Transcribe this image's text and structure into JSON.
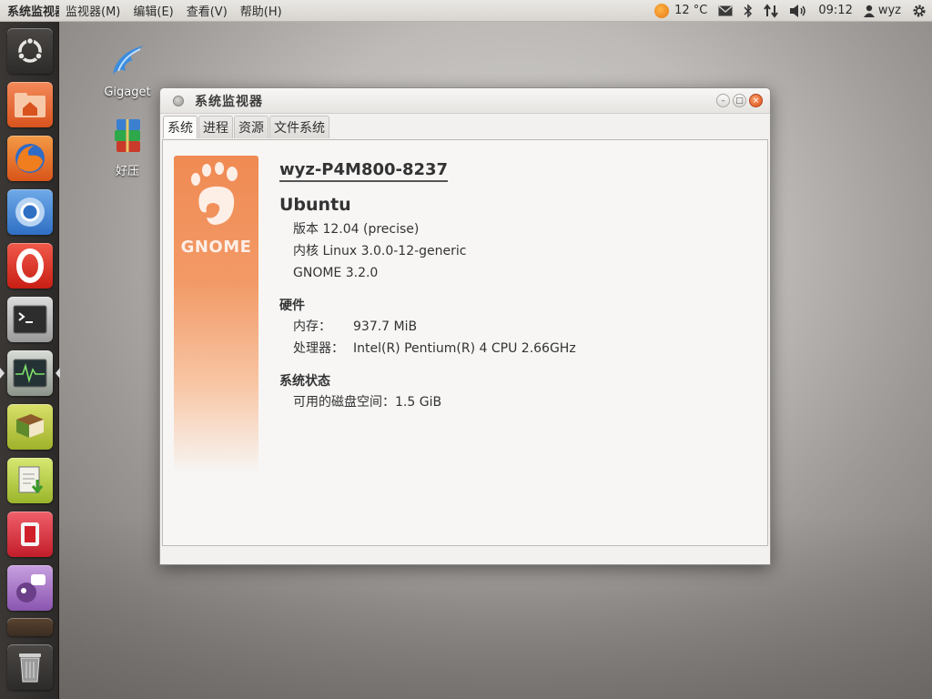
{
  "top_panel": {
    "app_title": "系统监视器",
    "menus": [
      "监视器(M)",
      "编辑(E)",
      "查看(V)",
      "帮助(H)"
    ],
    "temperature": "12 °C",
    "time": "09:12",
    "user": "wyz"
  },
  "launcher": {
    "items": [
      "dash-home",
      "home-folder",
      "firefox",
      "chromium",
      "opera",
      "terminal",
      "system-monitor",
      "dictionary",
      "software-updater",
      "startup-disk",
      "pidgin",
      "trash"
    ]
  },
  "desktop": {
    "icons": [
      {
        "label": "Gigaget",
        "icon": "gigaget-icon"
      },
      {
        "label": "好压",
        "icon": "haozip-icon"
      }
    ]
  },
  "window": {
    "title": "系统监视器",
    "tabs": [
      "系统",
      "进程",
      "资源",
      "文件系统"
    ],
    "banner_text": "GNOME",
    "hostname": "wyz-P4M800-8237",
    "os_name": "Ubuntu",
    "version": "版本 12.04 (precise)",
    "kernel": "内核 Linux 3.0.0-12-generic",
    "gnome": "GNOME 3.2.0",
    "hardware_title": "硬件",
    "memory_label": "内存：",
    "memory_value": "937.7 MiB",
    "cpu_label": "处理器：",
    "cpu_value": "Intel(R) Pentium(R) 4 CPU 2.66GHz",
    "status_title": "系统状态",
    "disk_label": "可用的磁盘空间：",
    "disk_value": "1.5 GiB"
  }
}
